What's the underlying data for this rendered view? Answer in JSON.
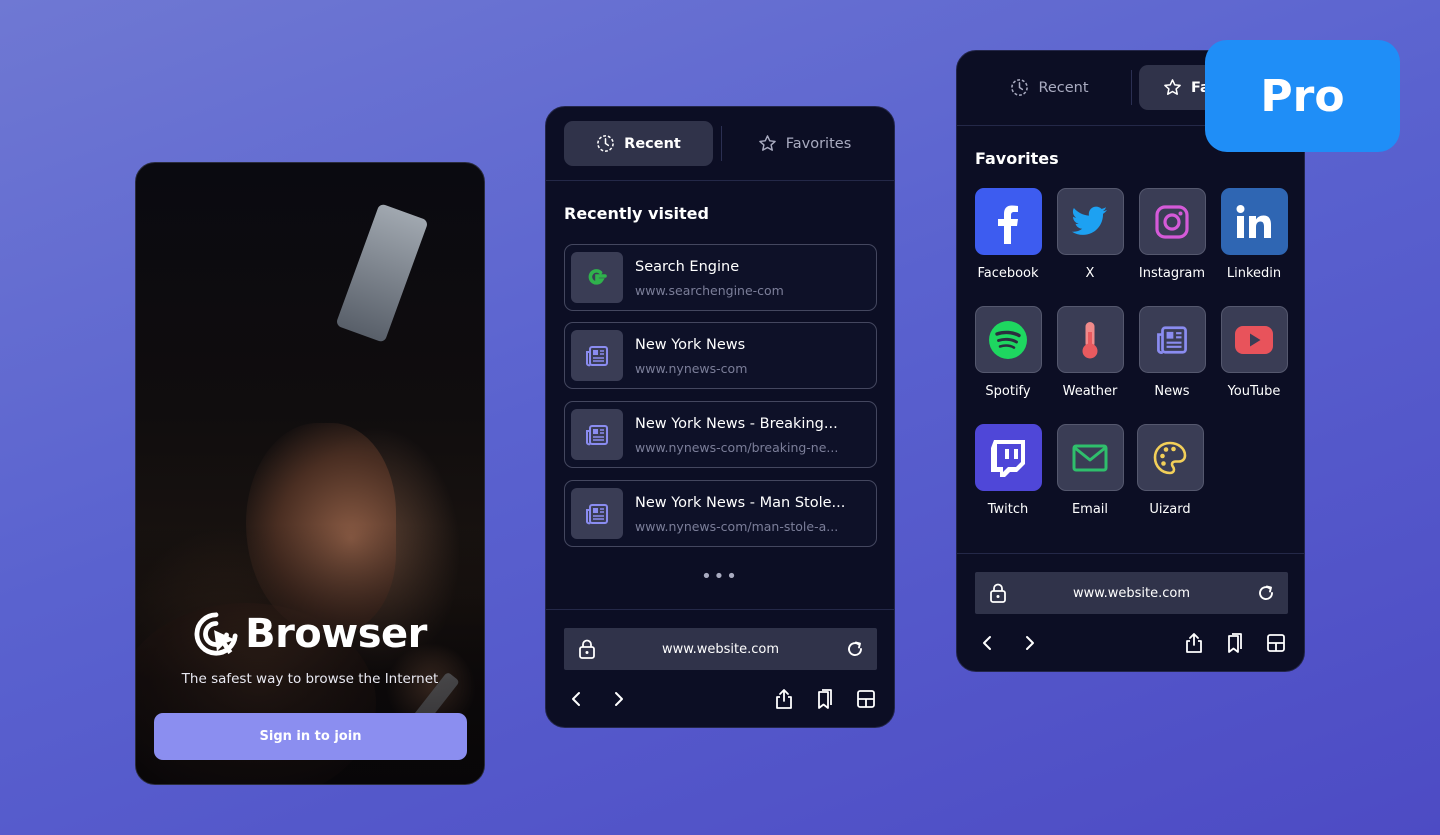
{
  "splash": {
    "brand_name": "Browser",
    "tagline": "The safest way to browse the Internet",
    "signin_label": "Sign in to join",
    "accent": "#8b8ef0"
  },
  "recent_screen": {
    "tabs": [
      {
        "label": "Recent",
        "icon": "clock-icon",
        "active": true
      },
      {
        "label": "Favorites",
        "icon": "star-icon",
        "active": false
      }
    ],
    "section_title": "Recently visited",
    "items": [
      {
        "title": "Search Engine",
        "url": "www.searchengine-com",
        "icon": "g-logo-icon"
      },
      {
        "title": "New York News",
        "url": "www.nynews-com",
        "icon": "newspaper-icon"
      },
      {
        "title": "New York News - Breaking...",
        "url": "www.nynews-com/breaking-ne...",
        "icon": "newspaper-icon"
      },
      {
        "title": "New York News - Man Stole...",
        "url": "www.nynews-com/man-stole-a...",
        "icon": "newspaper-icon"
      }
    ],
    "more": "•••",
    "url_bar": "www.website.com"
  },
  "favorites_screen": {
    "tabs": [
      {
        "label": "Recent",
        "icon": "clock-icon",
        "active": false
      },
      {
        "label": "Fa",
        "icon": "star-icon",
        "active": true
      }
    ],
    "section_title": "Favorites",
    "items": [
      {
        "label": "Facebook",
        "icon": "facebook-icon",
        "color": "#3d5cf0"
      },
      {
        "label": "X",
        "icon": "twitter-bird-icon",
        "color": "#3a3d55"
      },
      {
        "label": "Instagram",
        "icon": "instagram-icon",
        "color": "#3a3d55"
      },
      {
        "label": "Linkedin",
        "icon": "linkedin-icon",
        "color": "#2f66b3"
      },
      {
        "label": "Spotify",
        "icon": "spotify-icon",
        "color": "#3a3d55"
      },
      {
        "label": "Weather",
        "icon": "thermometer-icon",
        "color": "#3a3d55"
      },
      {
        "label": "News",
        "icon": "newspaper-icon",
        "color": "#3a3d55"
      },
      {
        "label": "YouTube",
        "icon": "youtube-icon",
        "color": "#3a3d55"
      },
      {
        "label": "Twitch",
        "icon": "twitch-icon",
        "color": "#4f47d8"
      },
      {
        "label": "Email",
        "icon": "mail-icon",
        "color": "#3a3d55"
      },
      {
        "label": "Uizard",
        "icon": "palette-icon",
        "color": "#3a3d55"
      }
    ],
    "url_bar": "www.website.com"
  },
  "badge": {
    "label": "Pro",
    "color": "#1f8ef7"
  }
}
